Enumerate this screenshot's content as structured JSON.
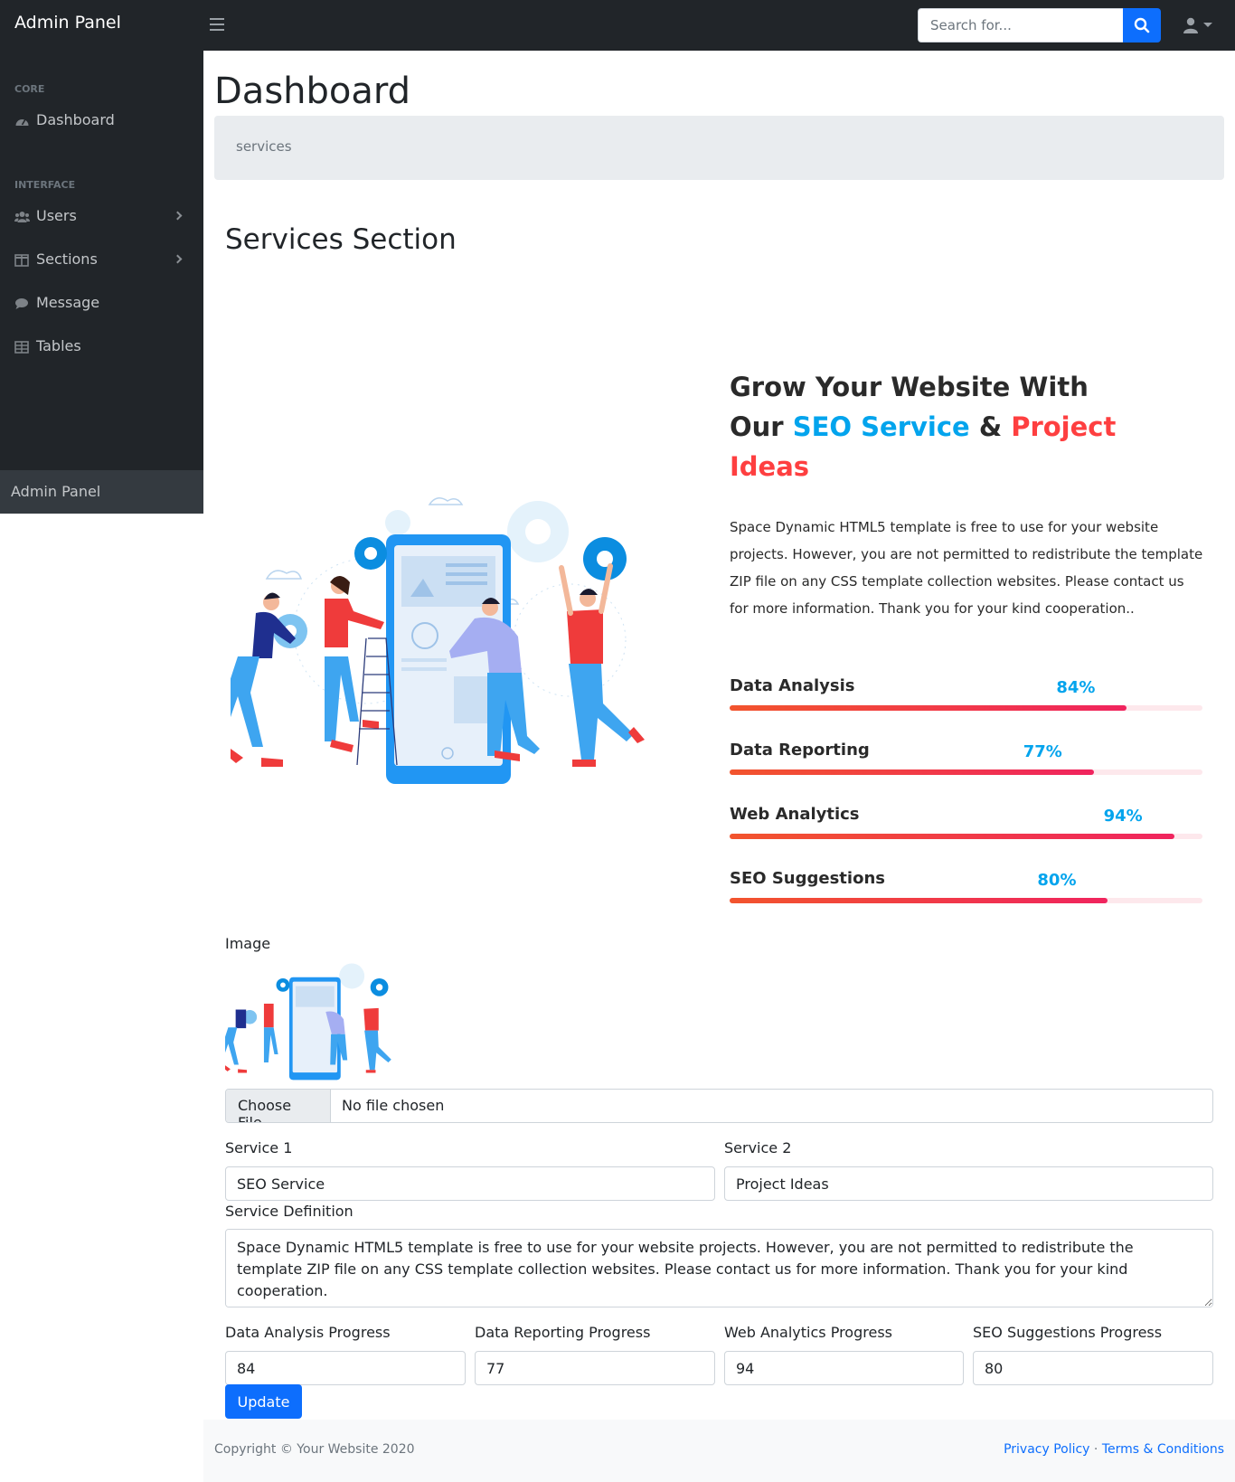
{
  "app": {
    "brand": "Admin Panel"
  },
  "topnav": {
    "search_placeholder": "Search for...",
    "search_icon": "search-icon",
    "user_icon": "user-icon"
  },
  "sidebar": {
    "headings": [
      "CORE",
      "INTERFACE"
    ],
    "items": [
      {
        "label": "Dashboard",
        "icon": "tachometer-icon"
      },
      {
        "label": "Users",
        "icon": "users-icon",
        "has_submenu": true
      },
      {
        "label": "Sections",
        "icon": "columns-icon",
        "has_submenu": true
      },
      {
        "label": "Message",
        "icon": "comment-icon"
      },
      {
        "label": "Tables",
        "icon": "table-icon"
      }
    ],
    "footer": "Admin Panel"
  },
  "page": {
    "title": "Dashboard",
    "breadcrumb": "services",
    "section_title": "Services Section"
  },
  "preview": {
    "headline_part1": "Grow Your Website With Our ",
    "headline_blue": "SEO Service",
    "headline_amp": " & ",
    "headline_red": "Project Ideas",
    "description": "Space Dynamic HTML5 template is free to use for your website projects. However, you are not permitted to redistribute the template ZIP file on any CSS template collection websites. Please contact us for more information. Thank you for your kind cooperation..",
    "skills": [
      {
        "name": "Data Analysis",
        "percent_label": "84%",
        "value": 84
      },
      {
        "name": "Data Reporting",
        "percent_label": "77%",
        "value": 77
      },
      {
        "name": "Web Analytics",
        "percent_label": "94%",
        "value": 94
      },
      {
        "name": "SEO Suggestions",
        "percent_label": "80%",
        "value": 80
      }
    ],
    "colors": {
      "blue": "#03a4ed",
      "red": "#fe3f40",
      "bar_start": "#f2542d",
      "bar_end": "#f0245e"
    }
  },
  "form": {
    "image_label": "Image",
    "file_button": "Choose File",
    "file_status": "No file chosen",
    "service1_label": "Service 1",
    "service1_value": "SEO Service",
    "service2_label": "Service 2",
    "service2_value": "Project Ideas",
    "definition_label": "Service Definition",
    "definition_value": "Space Dynamic HTML5 template is free to use for your website projects. However, you are not permitted to redistribute the template ZIP file on any CSS template collection websites. Please contact us for more information. Thank you for your kind cooperation.",
    "progress_fields": [
      {
        "label": "Data Analysis Progress",
        "value": "84"
      },
      {
        "label": "Data Reporting Progress",
        "value": "77"
      },
      {
        "label": "Web Analytics Progress",
        "value": "94"
      },
      {
        "label": "SEO Suggestions Progress",
        "value": "80"
      }
    ],
    "submit_label": "Update"
  },
  "footer": {
    "copyright": "Copyright © Your Website 2020",
    "privacy": "Privacy Policy",
    "separator": " · ",
    "terms": "Terms & Conditions"
  }
}
